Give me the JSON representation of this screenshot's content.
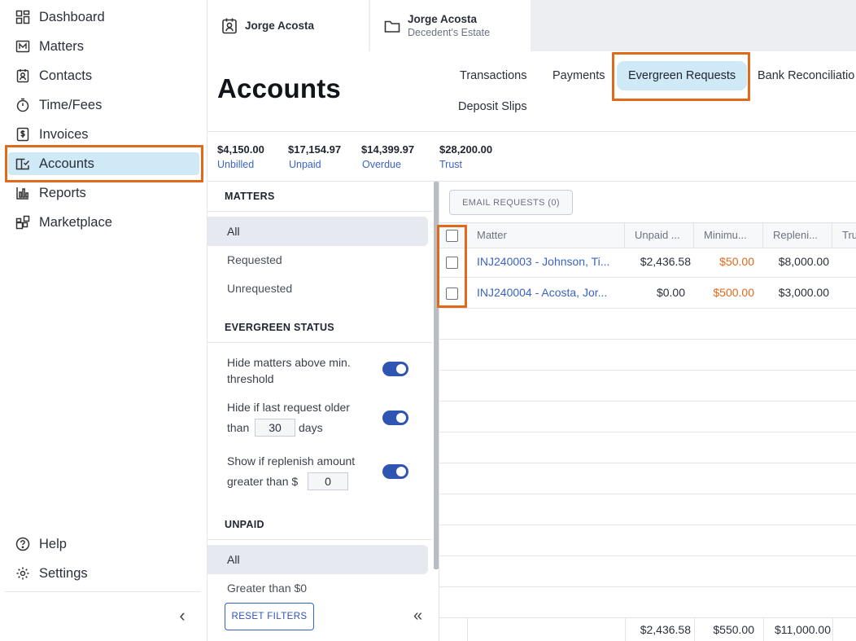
{
  "sidebar": {
    "items": [
      {
        "label": "Dashboard",
        "icon": "dashboard-icon"
      },
      {
        "label": "Matters",
        "icon": "matters-icon"
      },
      {
        "label": "Contacts",
        "icon": "contacts-icon"
      },
      {
        "label": "Time/Fees",
        "icon": "stopwatch-icon"
      },
      {
        "label": "Invoices",
        "icon": "dollar-document-icon"
      },
      {
        "label": "Accounts",
        "icon": "book-icon",
        "active": true
      },
      {
        "label": "Reports",
        "icon": "bar-chart-icon"
      },
      {
        "label": "Marketplace",
        "icon": "apps-icon"
      }
    ],
    "help_label": "Help",
    "settings_label": "Settings",
    "collapse_glyph": "‹"
  },
  "top_tabs": [
    {
      "title": "Jorge Acosta",
      "subtitle": "",
      "icon": "contact-card-icon"
    },
    {
      "title": "Jorge Acosta",
      "subtitle": "Decedent's Estate",
      "icon": "folder-icon"
    }
  ],
  "header": {
    "title": "Accounts",
    "tabs": [
      "Transactions",
      "Payments",
      "Evergreen Requests",
      "Bank Reconciliatio",
      "Deposit Slips"
    ],
    "active_tab": "Evergreen Requests"
  },
  "summary": [
    {
      "value": "$4,150.00",
      "label": "Unbilled"
    },
    {
      "value": "$17,154.97",
      "label": "Unpaid"
    },
    {
      "value": "$14,399.97",
      "label": "Overdue"
    },
    {
      "value": "$28,200.00",
      "label": "Trust"
    }
  ],
  "filters": {
    "matters_heading": "MATTERS",
    "matters_options": [
      "All",
      "Requested",
      "Unrequested"
    ],
    "matters_selected": "All",
    "evergreen_heading": "EVERGREEN STATUS",
    "hide_above_label": "Hide matters above min. threshold",
    "hide_older_label_a": "Hide if last request older",
    "hide_older_label_b": "than",
    "hide_older_value": "30",
    "hide_older_label_c": "days",
    "show_replenish_label_a": "Show if replenish amount",
    "show_replenish_label_b": "greater than $",
    "show_replenish_value": "0",
    "toggles_on": [
      true,
      true,
      true
    ],
    "unpaid_heading": "UNPAID",
    "unpaid_options": [
      "All",
      "Greater than $0"
    ],
    "unpaid_selected": "All",
    "reset_label": "RESET FILTERS",
    "collapse_glyph": "«"
  },
  "table": {
    "email_button": "EMAIL REQUESTS (0)",
    "columns": [
      "Matter",
      "Unpaid ...",
      "Minimu...",
      "Repleni...",
      "Tru"
    ],
    "rows": [
      {
        "matter": "INJ240003 - Johnson, Ti...",
        "unpaid": "$2,436.58",
        "minimum": "$50.00",
        "replenish": "$8,000.00"
      },
      {
        "matter": "INJ240004 - Acosta, Jor...",
        "unpaid": "$0.00",
        "minimum": "$500.00",
        "replenish": "$3,000.00"
      }
    ],
    "totals": {
      "unpaid": "$2,436.58",
      "minimum": "$550.00",
      "replenish": "$11,000.00"
    }
  },
  "colors": {
    "accent": "#3b63c4",
    "highlight": "#cfe9f6",
    "annotation": "#e06a1b",
    "toggle_on": "#2f55b2"
  }
}
